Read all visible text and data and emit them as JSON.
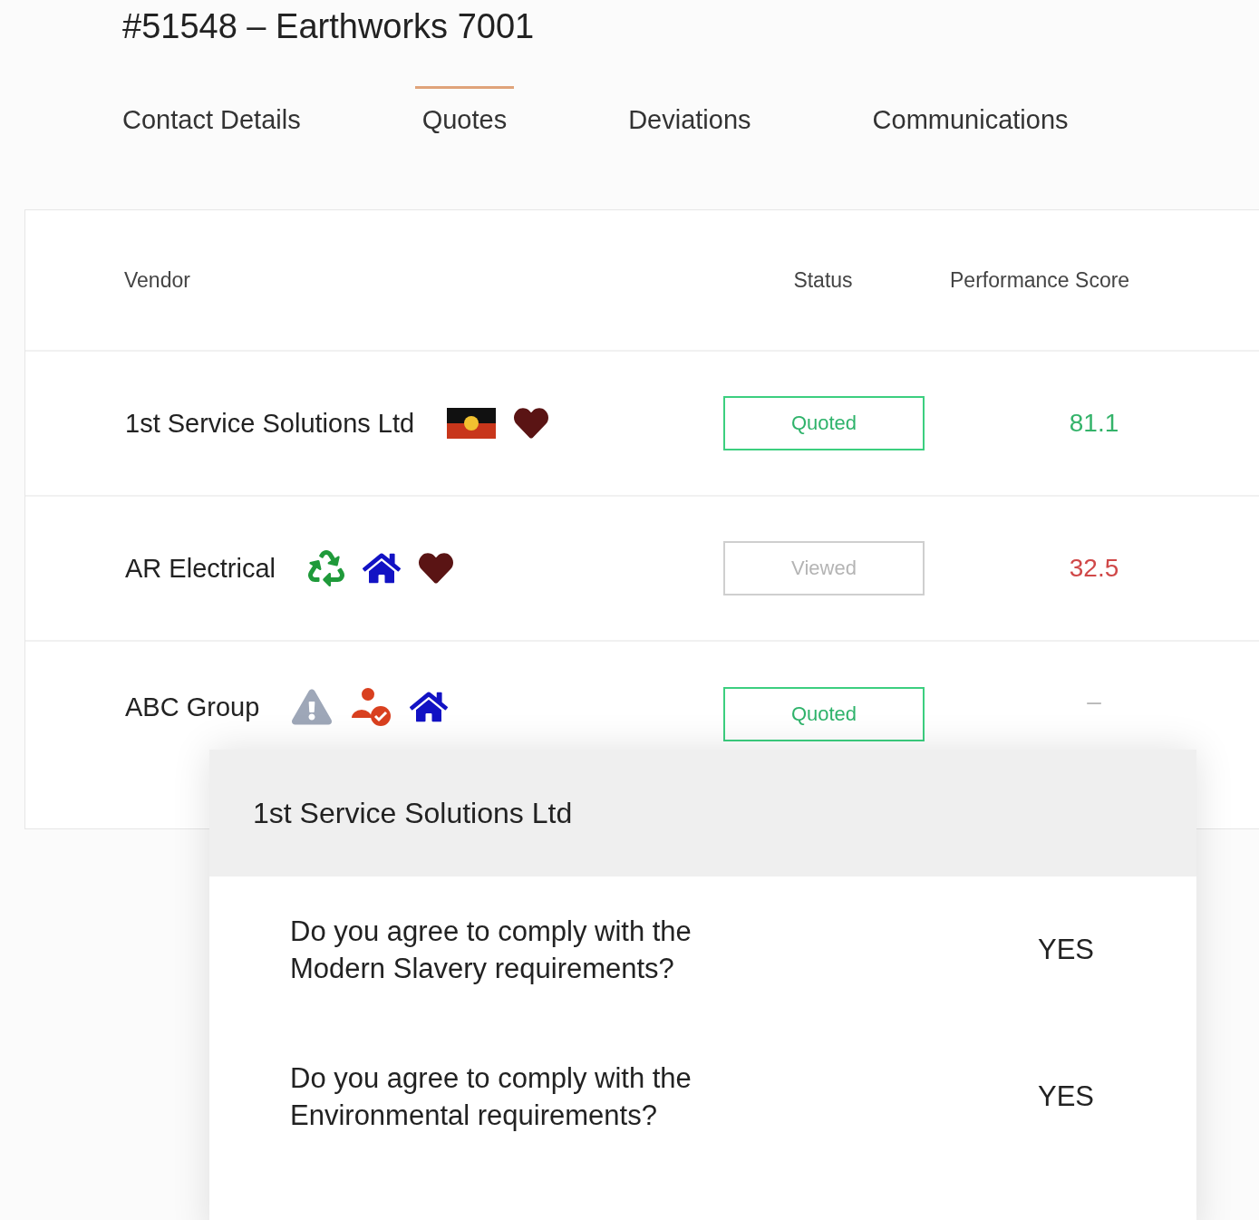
{
  "title": "#51548 – Earthworks 7001",
  "tabs": [
    {
      "label": "Contact Details",
      "selected": false
    },
    {
      "label": "Quotes",
      "selected": true
    },
    {
      "label": "Deviations",
      "selected": false
    },
    {
      "label": "Communications",
      "selected": false
    }
  ],
  "table": {
    "columns": [
      "Vendor",
      "Status",
      "Performance Score"
    ],
    "rows": [
      {
        "vendor": "1st Service Solutions Ltd",
        "badges": [
          {
            "kind": "flag"
          },
          {
            "kind": "heart"
          }
        ],
        "status": {
          "label": "Quoted",
          "kind": "quoted"
        },
        "score": {
          "text": "81.1",
          "color": "#34b36a"
        }
      },
      {
        "vendor": "AR Electrical",
        "badges": [
          {
            "kind": "recycle"
          },
          {
            "kind": "house"
          },
          {
            "kind": "heart"
          }
        ],
        "status": {
          "label": "Viewed",
          "kind": "viewed"
        },
        "score": {
          "text": "32.5",
          "color": "#d04848"
        }
      },
      {
        "vendor": "ABC Group",
        "badges": [
          {
            "kind": "warning"
          },
          {
            "kind": "person-check"
          },
          {
            "kind": "house"
          }
        ],
        "status": {
          "label": "Quoted",
          "kind": "quoted"
        },
        "score": {
          "text": "–",
          "color": "#b8b8b8"
        }
      }
    ]
  },
  "popover": {
    "title": "1st Service Solutions Ltd",
    "questions": [
      {
        "question": "Do you agree to comply with the Modern Slavery requirements?",
        "answer": "YES"
      },
      {
        "question": "Do you agree to comply with the Environmental requirements?",
        "answer": "YES"
      }
    ]
  }
}
